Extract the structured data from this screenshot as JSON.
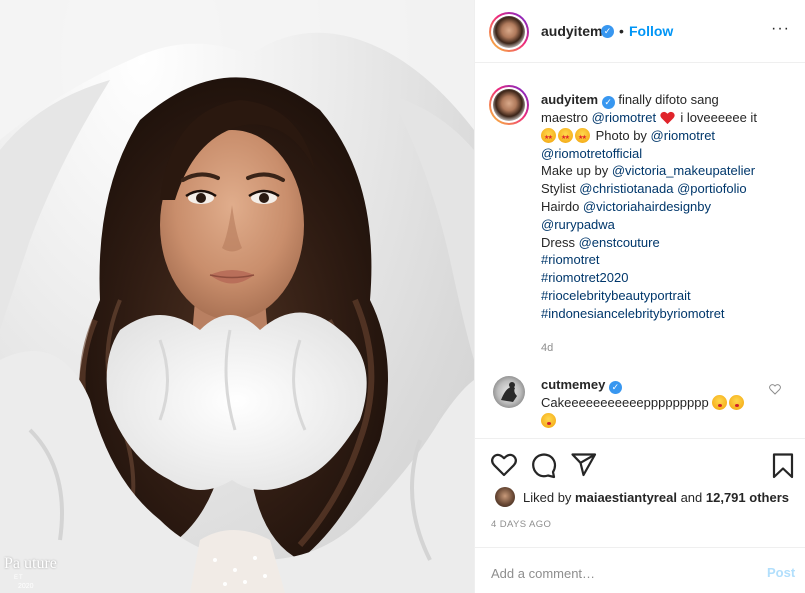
{
  "post": {
    "image_alt": "Portrait photo",
    "watermark": {
      "title": "Pa   uture",
      "sub": "ET",
      "year": "2020"
    }
  },
  "header": {
    "username": "audyitem",
    "separator": "•",
    "follow_label": "Follow",
    "more_label": "···"
  },
  "caption": {
    "username": "audyitem",
    "lines": [
      {
        "before": "finally difoto sang"
      },
      {
        "prefix": "maestro ",
        "link": "@riomotret",
        "suffix": " i loveeeeee it"
      },
      {
        "prefix": " Photo by ",
        "link": "@riomotret"
      },
      {
        "link": "@riomotretofficial"
      },
      {
        "prefix": "Make up by ",
        "link": "@victoria_makeupatelier"
      },
      {
        "prefix": "Stylist ",
        "link": "@christiotanada",
        "link2": "@portiofolio"
      },
      {
        "prefix": "Hairdo ",
        "link": "@victoriahairdesignby"
      },
      {
        "link": "@rurypadwa"
      },
      {
        "prefix": "Dress ",
        "link": "@enstcouture"
      },
      {
        "link": "#riomotret"
      },
      {
        "link": "#riomotret2020"
      },
      {
        "link": "#riocelebritybeautyportrait"
      },
      {
        "link": "#indonesiancelebritybyriomotret"
      }
    ],
    "time": "4d"
  },
  "comment": {
    "username": "cutmemey",
    "text_line1": "Cakeeeeeeeeeeeppppppppp",
    "text_line2": "",
    "like_icon": "heart-outline-icon"
  },
  "actions": {
    "icons": [
      "heart-outline-icon",
      "comment-icon",
      "share-icon",
      "bookmark-icon"
    ],
    "liked_prefix": "Liked by ",
    "liked_user": "maiaestiantyreal",
    "liked_middle": " and ",
    "liked_count": "12,791 others",
    "post_age": "4 DAYS AGO",
    "comment_placeholder": "Add a comment…",
    "post_label": "Post"
  },
  "colors": {
    "link": "#00376b",
    "follow": "#0095f6",
    "post_disabled": "#b2dffc",
    "verified": "#3897f0",
    "heart_emoji": "#ed4956"
  }
}
